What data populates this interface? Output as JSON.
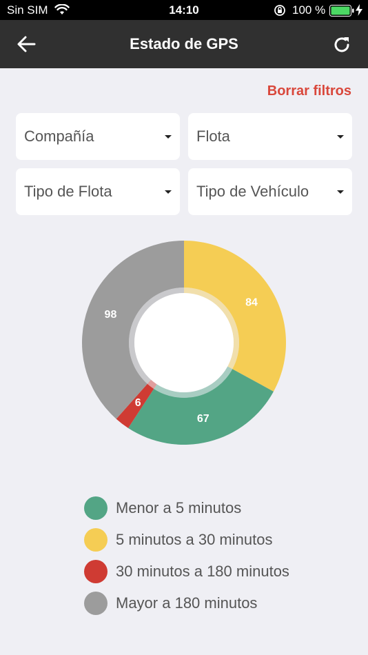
{
  "status_bar": {
    "carrier": "Sin SIM",
    "time": "14:10",
    "battery": "100 %"
  },
  "nav": {
    "title": "Estado de GPS",
    "back_icon": "arrow-left-icon",
    "refresh_icon": "refresh-icon"
  },
  "filters": {
    "clear_label": "Borrar filtros",
    "company": "Compañía",
    "fleet": "Flota",
    "fleet_type": "Tipo de Flota",
    "vehicle_type": "Tipo de Vehículo"
  },
  "chart_data": {
    "type": "pie",
    "donut": true,
    "start": "top",
    "direction": "clockwise",
    "slices": [
      {
        "label": "5 minutos a 30 minutos",
        "value": 84,
        "color": "#f5cd54"
      },
      {
        "label": "Menor a 5 minutos",
        "value": 67,
        "color": "#53a585"
      },
      {
        "label": "30 minutos a 180 minutos",
        "value": 6,
        "color": "#cf3b33"
      },
      {
        "label": "Mayor a 180 minutos",
        "value": 98,
        "color": "#9c9c9c"
      }
    ]
  },
  "legend": [
    {
      "label": "Menor a 5 minutos",
      "color": "#53a585"
    },
    {
      "label": "5 minutos a 30 minutos",
      "color": "#f5cd54"
    },
    {
      "label": "30 minutos a 180 minutos",
      "color": "#cf3b33"
    },
    {
      "label": "Mayor a 180 minutos",
      "color": "#9c9c9c"
    }
  ]
}
